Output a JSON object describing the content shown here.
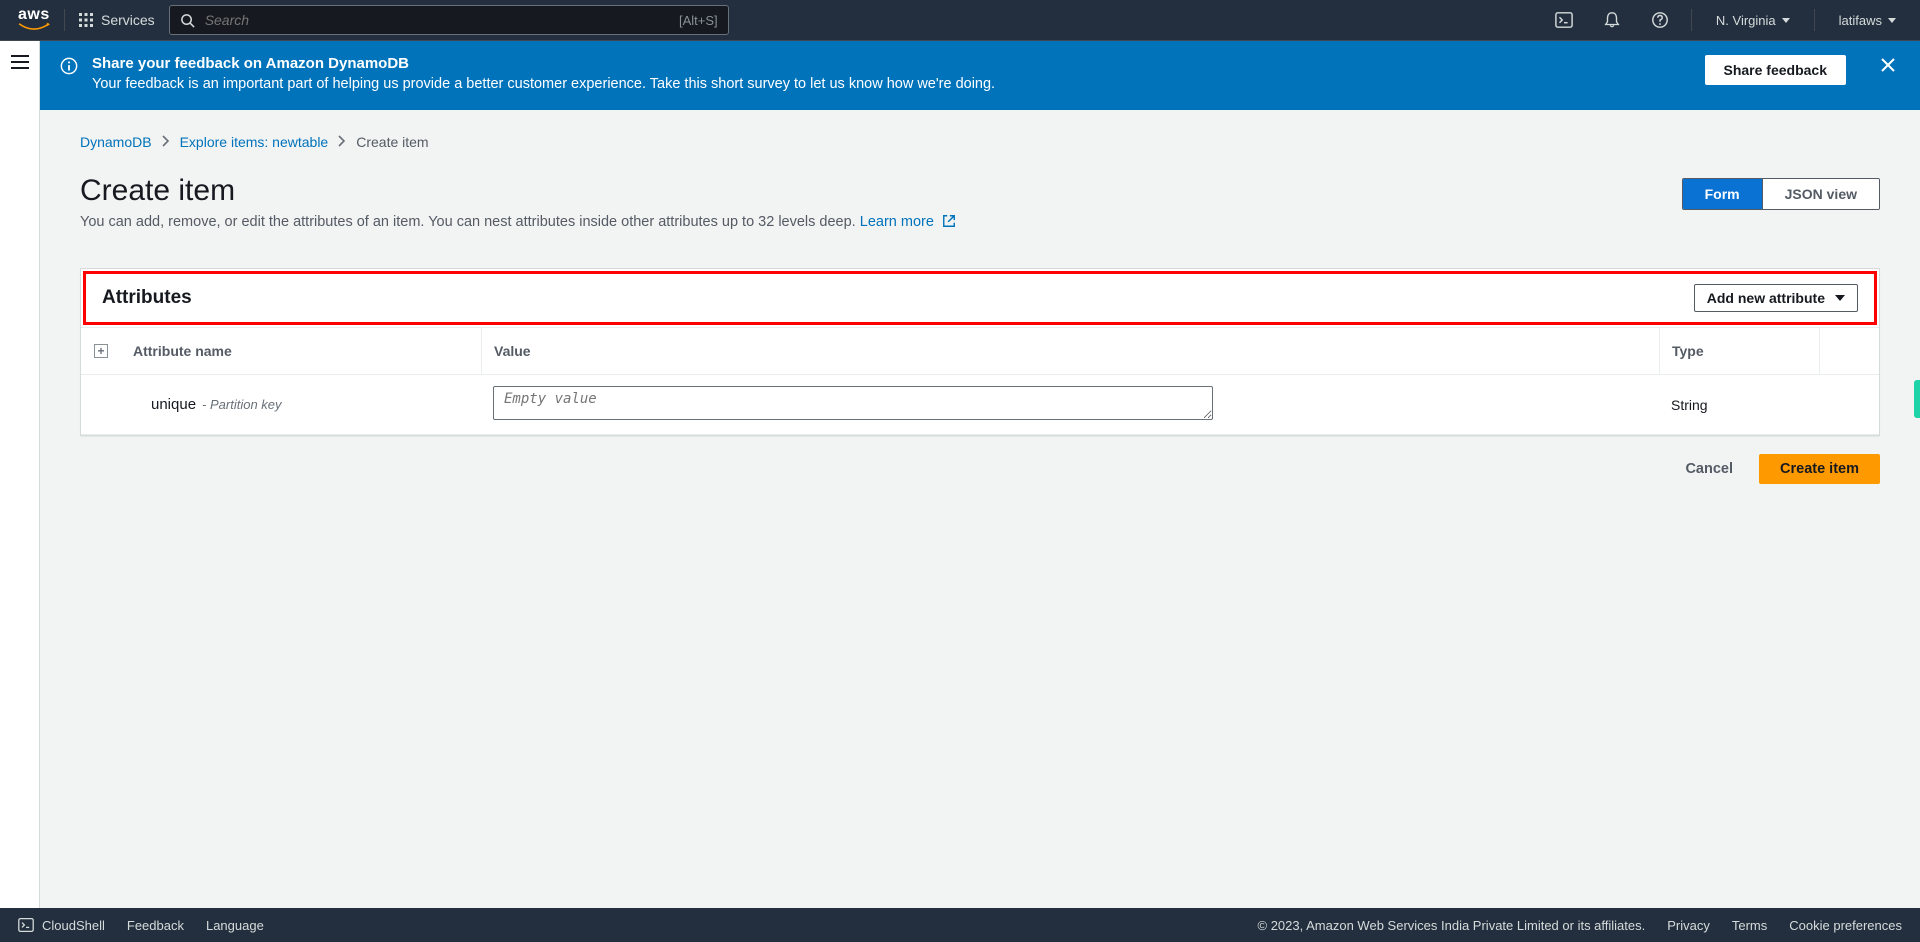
{
  "topnav": {
    "logo": "aws",
    "services": "Services",
    "search_placeholder": "Search",
    "search_shortcut": "[Alt+S]",
    "region": "N. Virginia",
    "user": "latifaws"
  },
  "banner": {
    "title": "Share your feedback on Amazon DynamoDB",
    "desc": "Your feedback is an important part of helping us provide a better customer experience. Take this short survey to let us know how we're doing.",
    "share_btn": "Share feedback"
  },
  "breadcrumbs": {
    "items": [
      "DynamoDB",
      "Explore items: newtable",
      "Create item"
    ]
  },
  "header": {
    "title": "Create item",
    "desc": "You can add, remove, or edit the attributes of an item. You can nest attributes inside other attributes up to 32 levels deep. ",
    "learn_more": "Learn more"
  },
  "view_toggle": {
    "form": "Form",
    "json": "JSON view"
  },
  "panel": {
    "title": "Attributes",
    "add_btn": "Add new attribute",
    "columns": {
      "name": "Attribute name",
      "value": "Value",
      "type": "Type"
    },
    "rows": [
      {
        "name": "unique",
        "hint": "- Partition key",
        "value_placeholder": "Empty value",
        "type": "String"
      }
    ]
  },
  "actions": {
    "cancel": "Cancel",
    "create": "Create item"
  },
  "footer": {
    "cloudshell": "CloudShell",
    "feedback": "Feedback",
    "language": "Language",
    "copyright": "© 2023, Amazon Web Services India Private Limited or its affiliates.",
    "privacy": "Privacy",
    "terms": "Terms",
    "cookies": "Cookie preferences"
  }
}
